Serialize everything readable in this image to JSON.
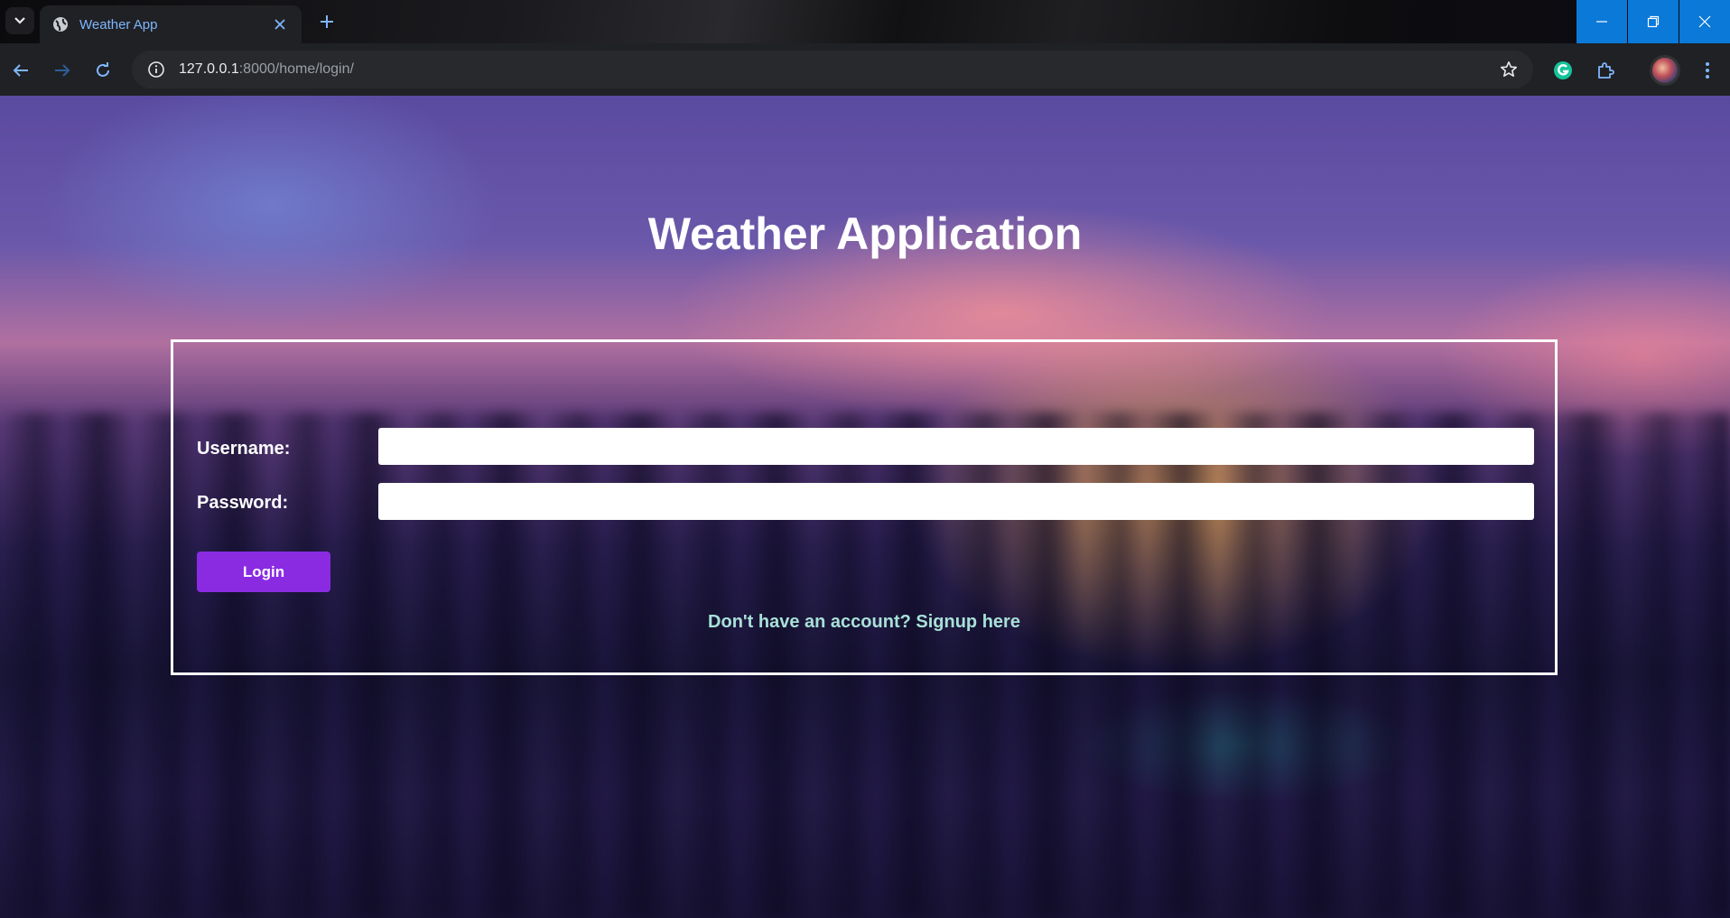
{
  "browser": {
    "tab": {
      "title": "Weather App"
    },
    "url": {
      "host": "127.0.0.1",
      "path": ":8000/home/login/"
    }
  },
  "page": {
    "heading": "Weather Application",
    "form": {
      "username_label": "Username:",
      "password_label": "Password:",
      "username_value": "",
      "password_value": "",
      "login_label": "Login",
      "signup_text": "Don't have an account? Signup here"
    }
  },
  "colors": {
    "accent_button": "#8a2be2",
    "link": "#a8e0d8",
    "window_controls": "#0a79d8"
  }
}
